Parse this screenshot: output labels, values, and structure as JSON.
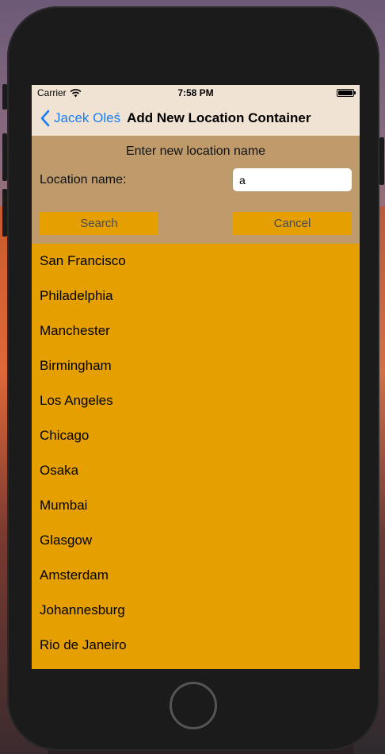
{
  "status_bar": {
    "carrier": "Carrier",
    "time": "7:58 PM"
  },
  "nav": {
    "back_label": "Jacek Oleś",
    "title": "Add New Location Container"
  },
  "form": {
    "prompt": "Enter new location name",
    "location_label": "Location name:",
    "location_value": "a",
    "search_label": "Search",
    "cancel_label": "Cancel"
  },
  "results": [
    "San Francisco",
    "Philadelphia",
    "Manchester",
    "Birmingham",
    "Los Angeles",
    "Chicago",
    "Osaka",
    "Mumbai",
    "Glasgow",
    "Amsterdam",
    "Johannesburg",
    "Rio de Janeiro"
  ],
  "colors": {
    "nav_background": "#f0e3d3",
    "form_background": "#bf9a6b",
    "accent": "#e5a000",
    "link": "#1a7ef5"
  }
}
